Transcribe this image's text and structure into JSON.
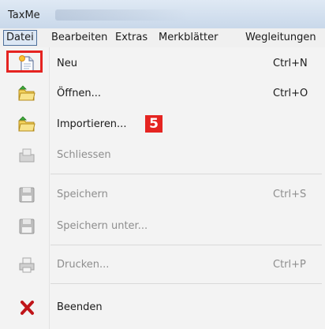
{
  "window": {
    "title": "TaxMe"
  },
  "menubar": {
    "items": [
      {
        "label": "Datei"
      },
      {
        "label": "Bearbeiten"
      },
      {
        "label": "Extras"
      },
      {
        "label": "Merkblätter"
      },
      {
        "label": "Wegleitungen"
      }
    ]
  },
  "file_menu": {
    "items": [
      {
        "label": "Neu",
        "shortcut": "Ctrl+N",
        "icon": "new-document-icon",
        "enabled": true
      },
      {
        "label": "Öffnen...",
        "shortcut": "Ctrl+O",
        "icon": "open-folder-icon",
        "enabled": true
      },
      {
        "label": "Importieren...",
        "shortcut": "",
        "icon": "import-folder-icon",
        "enabled": true
      },
      {
        "label": "Schliessen",
        "shortcut": "",
        "icon": "close-folder-icon",
        "enabled": false
      },
      {
        "label": "Speichern",
        "shortcut": "Ctrl+S",
        "icon": "save-icon",
        "enabled": false
      },
      {
        "label": "Speichern unter...",
        "shortcut": "",
        "icon": "save-as-icon",
        "enabled": false
      },
      {
        "label": "Drucken...",
        "shortcut": "Ctrl+P",
        "icon": "printer-icon",
        "enabled": false
      },
      {
        "label": "Beenden",
        "shortcut": "",
        "icon": "exit-x-icon",
        "enabled": true
      }
    ]
  },
  "annotation": {
    "step_number": "5",
    "color": "#e52421"
  }
}
